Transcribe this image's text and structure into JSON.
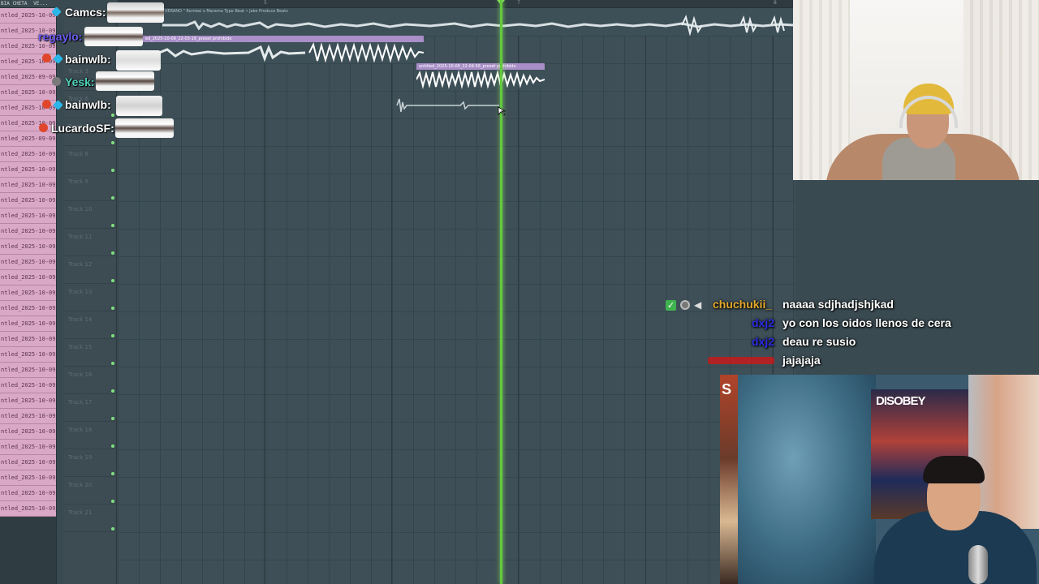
{
  "playlist": {
    "toolbar_label": "BIA CHETA",
    "toolbar_dropdown": "VE...",
    "ruler_numbers": [
      "5",
      "7",
      "8"
    ],
    "track_labels": [
      "Track 3",
      "Track 6",
      "Track 7",
      "Track 8",
      "Track 9",
      "Track 10",
      "Track 11",
      "Track 12",
      "Track 13",
      "Track 14",
      "Track 15",
      "Track 16",
      "Track 17",
      "Track 18",
      "Track 19",
      "Track 20",
      "Track 21"
    ],
    "patterns": [
      "ntled_2025-10-09_2",
      "ntled_2025-10-09_2",
      "ntled_2025-10-09_2",
      "ntled_2025-10-09_2",
      "ntled_2025-09-09_2",
      "ntled_2025-10-09_22",
      "ntled_2025-10-09_2",
      "ntled_2025-10-09_2",
      "ntled_2025-09-09_2",
      "ntled_2025-10-09_2",
      "ntled_2025-10-09_22",
      "ntled_2025-10-09_22",
      "ntled_2025-10-09_22",
      "ntled_2025-10-09_22",
      "ntled_2025-10-09_22",
      "ntled_2025-10-09_22",
      "ntled_2025-10-09_22",
      "ntled_2025-10-09_22",
      "ntled_2025-10-09_22",
      "ntled_2025-10-09_22",
      "ntled_2025-10-09_22",
      "ntled_2025-10-09_22",
      "ntled_2025-10-09_22",
      "ntled_2025-10-09_22",
      "ntled_2025-10-09_22",
      "ntled_2025-10-09_22",
      "ntled_2025-10-09_22",
      "ntled_2025-10-09_22",
      "ntled_2025-10-09_22",
      "ntled_2025-10-09_22",
      "ntled_2025-10-09_22",
      "ntled_2025-10-09_22",
      "ntled_2025-10-09_22"
    ],
    "clips": {
      "clip1_title": "VERANO  \"  Rombai x Marama Type Beat • Jake Produce Beats",
      "clip2_title": "ed_2025-10-09_22-03-16_preset prohibido",
      "clip3_title": "untitled_2025-10-09_22-04-56_preset prohibido"
    },
    "colors": {
      "playhead": "#63c93f",
      "clip_purple": "#a98ec7",
      "pattern_pink": "#d9a8c6"
    }
  },
  "overlay_chat": {
    "names": [
      {
        "name": "Camcs:",
        "color": "#ffffff"
      },
      {
        "name": "regaylo:",
        "color": "#6a5cf0"
      },
      {
        "name": "bainwlb:",
        "color": "#ffffff"
      },
      {
        "name": "Yesk:",
        "color": "#4fd1b8"
      },
      {
        "name": "bainwlb:",
        "color": "#ffffff"
      },
      {
        "name": "LucardoSF:",
        "color": "#ffffff"
      }
    ]
  },
  "chat": {
    "messages": [
      {
        "user": "chuchukii_",
        "user_color": "#e3a92c",
        "text": "naaaa sdjhadjshjkad",
        "badges": [
          "check-badge-icon",
          "circle-badge-icon",
          "speaker-badge-icon"
        ]
      },
      {
        "user": "dxj2",
        "user_color": "#2a2ae0",
        "text": "yo con los oidos llenos de cera"
      },
      {
        "user": "dxj2",
        "user_color": "#2a2ae0",
        "text": "deau re susio"
      },
      {
        "user": "",
        "user_color": "#c41a1a",
        "text": "jajajaja"
      }
    ]
  },
  "webcam_bottom": {
    "poster_text": "DISOBEY",
    "side_text": "S"
  }
}
